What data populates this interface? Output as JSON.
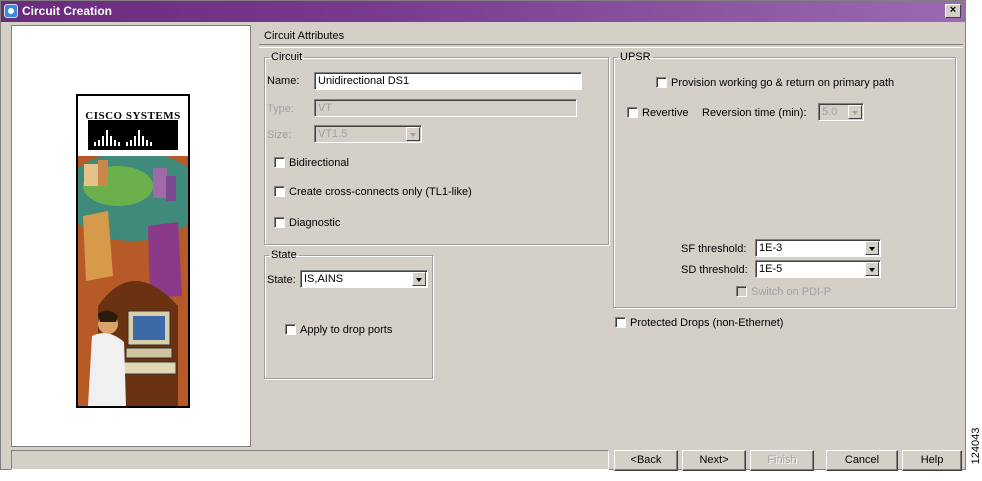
{
  "window": {
    "title": "Circuit Creation",
    "close_glyph": "×"
  },
  "logo": {
    "company": "Cisco Systems"
  },
  "panel": {
    "title": "Circuit Attributes"
  },
  "circuit": {
    "legend": "Circuit",
    "name_label": "Name:",
    "name_value": "Unidirectional DS1",
    "type_label": "Type:",
    "type_value": "VT",
    "size_label": "Size:",
    "size_value": "VT1.5",
    "bidirectional": {
      "label": "Bidirectional",
      "checked": false
    },
    "cross_connects": {
      "label": "Create cross-connects only (TL1-like)",
      "checked": false
    },
    "diagnostic": {
      "label": "Diagnostic",
      "checked": false
    }
  },
  "state": {
    "legend": "State",
    "state_label": "State:",
    "state_value": "IS,AINS",
    "apply_drop_ports": {
      "label": "Apply to drop ports",
      "checked": false
    }
  },
  "upsr": {
    "legend": "UPSR",
    "provision_primary": {
      "label": "Provision working go & return on primary path",
      "checked": false
    },
    "revertive": {
      "label": "Revertive",
      "checked": false
    },
    "reversion_label": "Reversion time (min):",
    "reversion_value": "5.0",
    "sf_label": "SF threshold:",
    "sf_value": "1E-3",
    "sd_label": "SD threshold:",
    "sd_value": "1E-5",
    "switch_pdip": {
      "label": "Switch on PDI-P",
      "checked": false
    }
  },
  "protected_drops": {
    "label": "Protected Drops (non-Ethernet)",
    "checked": false
  },
  "buttons": {
    "back": "<Back",
    "next": "Next>",
    "finish": "Finish",
    "cancel": "Cancel",
    "help": "Help"
  },
  "watermark": "124043",
  "colors": {
    "titlebar": "#7a3b8f",
    "dialog_bg": "#d4d0c8"
  }
}
